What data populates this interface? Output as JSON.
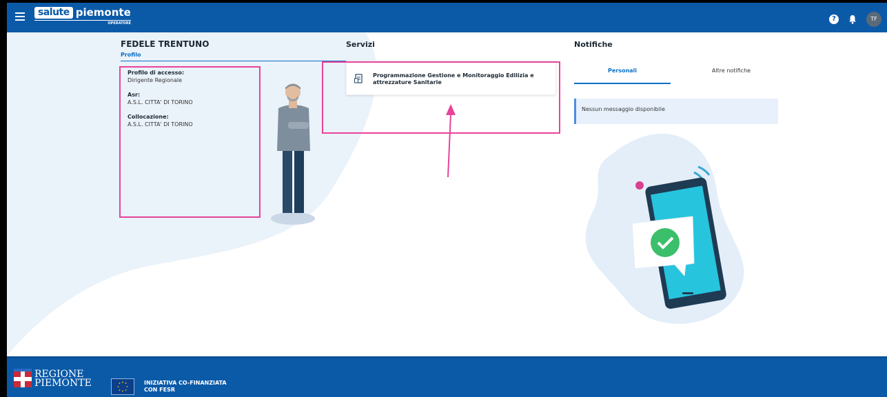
{
  "header": {
    "logo_box": "salute",
    "logo_word": "piemonte",
    "logo_sub": "OPERATORE",
    "help_glyph": "?",
    "avatar_initials": "TF",
    "color": "#0b5aa8"
  },
  "profile": {
    "name": "FEDELE TRENTUNO",
    "tab": "Profilo",
    "fields": [
      {
        "label": "Profilo di accesso:",
        "value": "Dirigente Regionale"
      },
      {
        "label": "Asr:",
        "value": "A.S.L. CITTA' DI TORINO"
      },
      {
        "label": "Collocazione:",
        "value": "A.S.L. CITTA' DI TORINO"
      }
    ]
  },
  "services": {
    "title": "Servizi",
    "items": [
      {
        "label": "Programmazione Gestione e Monitoraggio Edilizia e attrezzature Sanitarie",
        "icon": "document-icon"
      }
    ]
  },
  "notifications": {
    "title": "Notifiche",
    "tabs": [
      {
        "label": "Personali",
        "active": true
      },
      {
        "label": "Altre notifiche",
        "active": false
      }
    ],
    "empty_message": "Nessun messaggio disponibile"
  },
  "footer": {
    "region_line1": "REGIONE",
    "region_line2": "PIEMONTE",
    "eu_line1": "INIZIATIVA CO-FINANZIATA",
    "eu_line2": "CON FESR"
  },
  "colors": {
    "highlight": "#e8439a",
    "accent": "#0b6fc5",
    "blob": "#e7f0f9"
  }
}
